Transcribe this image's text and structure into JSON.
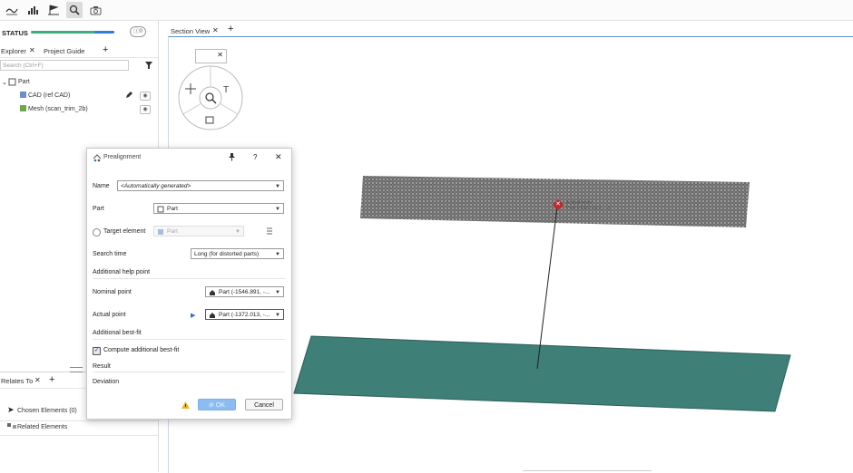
{
  "toolbar": {
    "icons": [
      "curve-icon",
      "histogram-icon",
      "flag-chart-icon",
      "search-icon",
      "camera-icon"
    ]
  },
  "status": {
    "label": "STATUS",
    "progress": 0.8,
    "info_count": "0"
  },
  "explorer": {
    "tabs": [
      {
        "label": "Explorer"
      },
      {
        "label": "Project Guide"
      }
    ],
    "search_placeholder": "Search (Ctrl+F)",
    "tree": {
      "root": "Part",
      "children": [
        {
          "label": "CAD (ref CAD)"
        },
        {
          "label": "Mesh (scan_trim_2b)"
        }
      ]
    }
  },
  "relates": {
    "tab_label": "Relates To",
    "chosen": "Chosen Elements (0)",
    "related": "Related Elements"
  },
  "viewport": {
    "tab_label": "Section View",
    "annotation": {
      "title": "Actual point",
      "sub": "Part (-1372.013, ...)"
    }
  },
  "dialog": {
    "title": "Prealignment",
    "name_label": "Name",
    "name_value": "<Automatically generated>",
    "part_label": "Part",
    "part_value": "Part",
    "target_label": "Target element",
    "target_value": "Part",
    "search_time_label": "Search time",
    "search_time_value": "Long (for distorted parts)",
    "help_section": "Additional help point",
    "nominal_label": "Nominal point",
    "nominal_value": "Part (-1546.891, -...",
    "actual_label": "Actual point",
    "actual_value": "Part (-1372.013, -...",
    "bestfit_section": "Additional best-fit",
    "compute_label": "Compute additional best-fit",
    "compute_checked": true,
    "result_section": "Result",
    "deviation_label": "Deviation",
    "ok_label": "OK",
    "cancel_label": "Cancel",
    "help_symbol": "?"
  }
}
